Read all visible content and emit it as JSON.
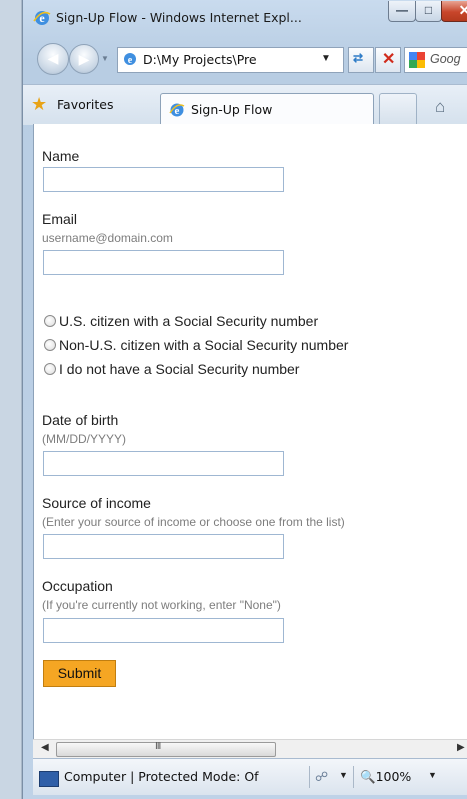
{
  "window": {
    "title": "Sign-Up Flow - Windows Internet Expl...",
    "controls": {
      "minimize": "—",
      "maximize": "□",
      "close": "✕"
    }
  },
  "nav": {
    "address": "D:\\My Projects\\Pre",
    "search_text": "Goog"
  },
  "favorites_bar": {
    "favorites_label": "Favorites",
    "active_tab": "Sign-Up Flow"
  },
  "form": {
    "name_label": "Name",
    "email_label": "Email",
    "email_hint": "username@domain.com",
    "radios": [
      "U.S. citizen with a Social Security number",
      "Non-U.S. citizen with a Social Security number",
      "I do not have a Social Security number"
    ],
    "dob_label": "Date of birth",
    "dob_hint": "(MM/DD/YYYY)",
    "income_label": "Source of income",
    "income_hint": "(Enter your source of income or choose one from the list)",
    "occupation_label": "Occupation",
    "occupation_hint": "(If you're currently not working, enter \"None\")",
    "submit_label": "Submit"
  },
  "scrollbar": {
    "grip": "III"
  },
  "status_bar": {
    "zone_text": "Computer | Protected Mode: Of",
    "zoom": "100%"
  },
  "colors": {
    "submit_bg": "#f5a623",
    "field_border": "#9fb7d2",
    "chrome_bg": "#c9dbee"
  }
}
